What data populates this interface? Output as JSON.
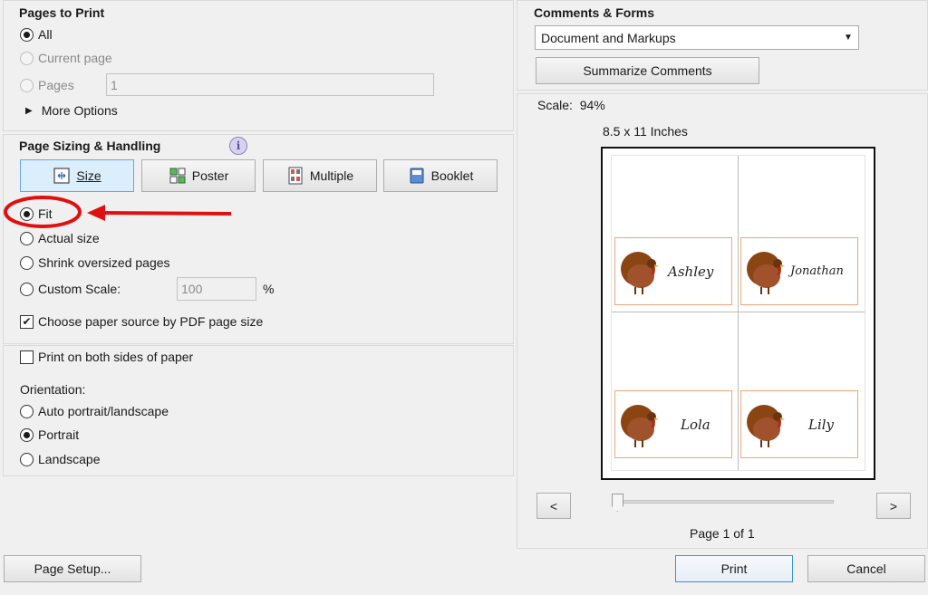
{
  "pages_to_print": {
    "title": "Pages to Print",
    "all_label": "All",
    "current_page_label": "Current page",
    "pages_label": "Pages",
    "pages_value": "1",
    "more_options_label": "More Options"
  },
  "page_sizing": {
    "title": "Page Sizing & Handling",
    "info_icon": "info-icon",
    "tabs": [
      {
        "label": "Size",
        "icon": "size-icon"
      },
      {
        "label": "Poster",
        "icon": "poster-icon"
      },
      {
        "label": "Multiple",
        "icon": "multiple-icon"
      },
      {
        "label": "Booklet",
        "icon": "booklet-icon"
      }
    ],
    "fit_label": "Fit",
    "actual_size_label": "Actual size",
    "shrink_label": "Shrink oversized pages",
    "custom_scale_label": "Custom Scale:",
    "custom_scale_value": "100",
    "percent_label": "%",
    "paper_source_label": "Choose paper source by PDF page size"
  },
  "duplex": {
    "both_sides_label": "Print on both sides of paper"
  },
  "orientation": {
    "title": "Orientation:",
    "auto_label": "Auto portrait/landscape",
    "portrait_label": "Portrait",
    "landscape_label": "Landscape"
  },
  "comments_forms": {
    "title": "Comments & Forms",
    "selected": "Document and Markups",
    "summarize_label": "Summarize Comments"
  },
  "preview": {
    "scale_text": "Scale:  94%",
    "paper_size": "8.5 x 11 Inches",
    "cards": [
      {
        "name": "Ashley"
      },
      {
        "name": "Jonathan"
      },
      {
        "name": "Lola"
      },
      {
        "name": "Lily"
      }
    ],
    "prev_label": "<",
    "next_label": ">",
    "page_indicator": "Page 1 of 1",
    "slider_position": 0
  },
  "footer": {
    "page_setup_label": "Page Setup...",
    "print_label": "Print",
    "cancel_label": "Cancel"
  },
  "colors": {
    "annotation_red": "#e01010",
    "card_border": "#f1a57a",
    "selected_tab": "#dbeefc"
  }
}
